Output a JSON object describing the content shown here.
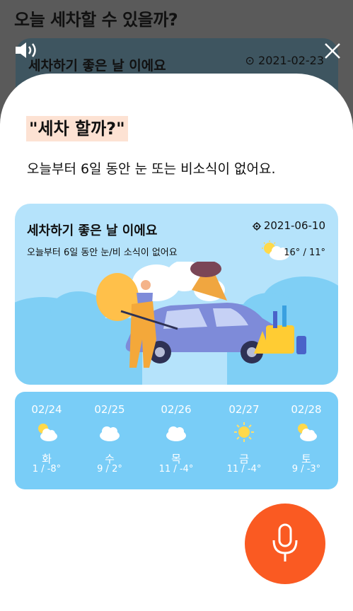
{
  "background": {
    "title": "오늘 세차할 수 있을까?",
    "card_title": "세차하기 좋은 날 이에요",
    "card_date": "2021-02-23"
  },
  "dialog": {
    "quote": "\"세차 할까?\"",
    "subtitle": "오늘부터 6일 동안 눈 또는 비소식이 없어요."
  },
  "weather_card": {
    "title": "세차하기 좋은 날 이에요",
    "date": "2021-06-10",
    "description": "오늘부터 6일 동안 눈/비 소식이 없어요",
    "temperature": "16° / 11°",
    "icon": "partly-cloudy-icon"
  },
  "forecast": [
    {
      "date": "02/24",
      "day": "화",
      "temp": "1 / -8°",
      "icon": "partly-cloudy-icon"
    },
    {
      "date": "02/25",
      "day": "수",
      "temp": "9 / 2°",
      "icon": "cloudy-icon"
    },
    {
      "date": "02/26",
      "day": "목",
      "temp": "11 / -4°",
      "icon": "cloudy-icon"
    },
    {
      "date": "02/27",
      "day": "금",
      "temp": "11 / -4°",
      "icon": "sunny-icon"
    },
    {
      "date": "02/28",
      "day": "토",
      "temp": "9 / -3°",
      "icon": "partly-cloudy-icon"
    }
  ],
  "colors": {
    "accent": "#fa5a22",
    "card": "#b5e3fb",
    "forecast": "#79cdf7",
    "highlight": "#fde2d3"
  }
}
